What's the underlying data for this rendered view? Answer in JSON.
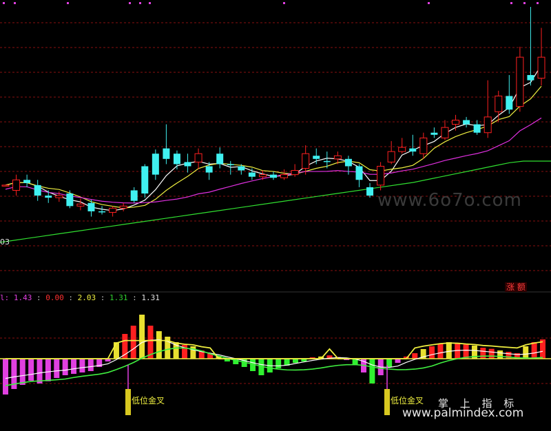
{
  "price_axis_label": "03",
  "watermark_site": "www.6o7o.com",
  "watermark_bottom": "www.palmindex.com",
  "brand_label": "掌 上 指 标",
  "limit_up_badge": "涨 额",
  "indicator_readout": {
    "prefix": "l:",
    "values": [
      "1.43",
      "0.00",
      "2.03",
      "1.31",
      "1.31"
    ],
    "colors": [
      "#e040e0",
      "#ff3030",
      "#f0f040",
      "#30d030",
      "#e6e6e6"
    ]
  },
  "colors": {
    "up": "#ff2020",
    "down": "#40f0f0",
    "ma_white": "#ffffff",
    "ma_yellow": "#f0f040",
    "ma_magenta": "#e030e0",
    "ma_green": "#30e030",
    "grid": "#8a1010"
  },
  "chart_data": [
    {
      "type": "candlestick",
      "title": "",
      "series": [
        {
          "name": "",
          "values": [
            [
              0.5,
              0.5,
              0.5,
              0.5
            ],
            [
              0.45,
              0.55,
              0.6,
              0.4
            ],
            [
              0.55,
              0.52,
              0.6,
              0.48
            ],
            [
              0.5,
              0.4,
              0.55,
              0.35
            ],
            [
              0.4,
              0.38,
              0.45,
              0.33
            ],
            [
              0.38,
              0.4,
              0.44,
              0.34
            ],
            [
              0.42,
              0.3,
              0.45,
              0.28
            ],
            [
              0.3,
              0.32,
              0.37,
              0.26
            ],
            [
              0.33,
              0.25,
              0.36,
              0.2
            ],
            [
              0.25,
              0.24,
              0.3,
              0.22
            ],
            [
              0.24,
              0.28,
              0.3,
              0.2
            ],
            [
              0.28,
              0.3,
              0.33,
              0.25
            ],
            [
              0.45,
              0.35,
              0.48,
              0.33
            ],
            [
              0.68,
              0.42,
              0.7,
              0.38
            ],
            [
              0.8,
              0.6,
              0.84,
              0.55
            ],
            [
              0.85,
              0.75,
              1.08,
              0.7
            ],
            [
              0.8,
              0.7,
              0.83,
              0.65
            ],
            [
              0.72,
              0.68,
              0.8,
              0.62
            ],
            [
              0.72,
              0.8,
              0.85,
              0.65
            ],
            [
              0.68,
              0.62,
              0.72,
              0.55
            ],
            [
              0.8,
              0.7,
              0.86,
              0.66
            ],
            [
              0.7,
              0.69,
              0.73,
              0.6
            ],
            [
              0.68,
              0.64,
              0.7,
              0.6
            ],
            [
              0.62,
              0.58,
              0.66,
              0.55
            ],
            [
              0.58,
              0.6,
              0.64,
              0.55
            ],
            [
              0.6,
              0.57,
              0.63,
              0.55
            ],
            [
              0.57,
              0.6,
              0.65,
              0.55
            ],
            [
              0.6,
              0.64,
              0.7,
              0.58
            ],
            [
              0.66,
              0.8,
              0.88,
              0.6
            ],
            [
              0.78,
              0.75,
              0.85,
              0.7
            ],
            [
              0.73,
              0.72,
              0.82,
              0.66
            ],
            [
              0.75,
              0.78,
              0.82,
              0.7
            ],
            [
              0.75,
              0.68,
              0.78,
              0.6
            ],
            [
              0.68,
              0.55,
              0.7,
              0.48
            ],
            [
              0.48,
              0.4,
              0.52,
              0.38
            ],
            [
              0.5,
              0.68,
              0.72,
              0.45
            ],
            [
              0.72,
              0.82,
              0.92,
              0.7
            ],
            [
              0.82,
              0.86,
              0.95,
              0.8
            ],
            [
              0.85,
              0.82,
              0.98,
              0.78
            ],
            [
              0.8,
              0.95,
              1.0,
              0.75
            ],
            [
              1.0,
              0.98,
              1.05,
              0.95
            ],
            [
              0.95,
              1.05,
              1.12,
              0.93
            ],
            [
              1.08,
              1.12,
              1.17,
              1.02
            ],
            [
              1.12,
              1.08,
              1.15,
              1.05
            ],
            [
              1.08,
              1.0,
              1.12,
              0.98
            ],
            [
              1.0,
              1.15,
              1.5,
              0.95
            ],
            [
              1.2,
              1.35,
              1.4,
              1.1
            ],
            [
              1.35,
              1.22,
              1.55,
              1.18
            ],
            [
              1.25,
              1.72,
              1.82,
              1.2
            ],
            [
              1.55,
              1.5,
              2.2,
              1.45
            ],
            [
              1.52,
              1.72,
              2.0,
              1.45
            ]
          ]
        }
      ]
    },
    {
      "type": "bar",
      "title": "",
      "ylim": [
        -2.4,
        2.4
      ],
      "series": [
        {
          "name": "",
          "values": [
            -1.3,
            -1.1,
            -0.95,
            -0.8,
            -0.9,
            -0.82,
            -0.7,
            -0.6,
            -0.55,
            -0.5,
            -0.45,
            -0.3,
            -0.1,
            0.6,
            0.9,
            1.2,
            1.6,
            1.2,
            1.0,
            0.8,
            0.6,
            0.5,
            0.45,
            0.3,
            0.2,
            0.1,
            -0.1,
            -0.2,
            -0.3,
            -0.45,
            -0.6,
            -0.5,
            -0.35,
            -0.25,
            -0.15,
            -0.1,
            0.05,
            0.08,
            0.12,
            0.06,
            -0.05,
            -0.2,
            -0.5,
            -0.9,
            -0.6,
            -0.3,
            -0.15,
            0.08,
            0.2,
            0.35,
            0.45,
            0.55,
            0.6,
            0.58,
            0.52,
            0.48,
            0.4,
            0.36,
            0.3,
            0.25,
            0.2,
            0.45,
            0.6,
            0.7
          ]
        }
      ]
    }
  ]
}
